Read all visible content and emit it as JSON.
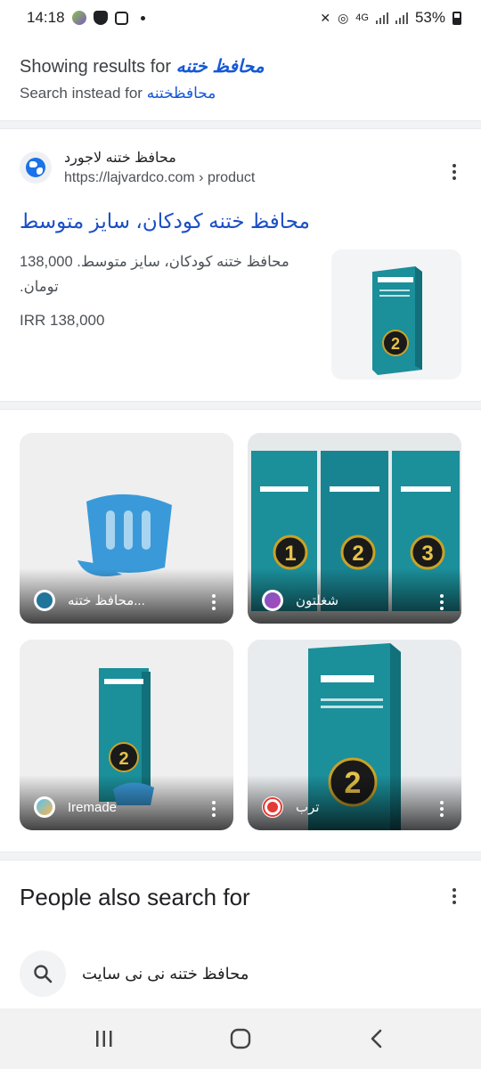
{
  "status_bar": {
    "time": "14:18",
    "network": "4G",
    "battery": "53%"
  },
  "spelling": {
    "showing_prefix": "Showing results for",
    "showing_query": "محافظ ختنه",
    "instead_prefix": "Search instead for",
    "instead_query": "محافظختنه"
  },
  "result": {
    "site_name": "محافظ ختنه لاجورد",
    "url": "https://lajvardco.com › product",
    "title": "محافظ ختنه کودکان، سایز متوسط",
    "snippet": "محافظ ختنه کودکان، سایز متوسط. 138,000 تومان.",
    "price": "IRR 138,000"
  },
  "images": [
    {
      "source": "محافظ ختنه...",
      "icon": "wordpress-icon"
    },
    {
      "source": "شغلتون",
      "icon": "shoghlton-icon"
    },
    {
      "source": "Iremade",
      "icon": "iremade-icon"
    },
    {
      "source": "ترب",
      "icon": "torob-icon"
    }
  ],
  "people_also_search": {
    "heading": "People also search for",
    "items": [
      "محافظ ختنه نی نی سایت"
    ]
  },
  "colors": {
    "link": "#1a4fc7",
    "product_teal": "#1b8f9a",
    "product_blue": "#3a9ad9"
  }
}
